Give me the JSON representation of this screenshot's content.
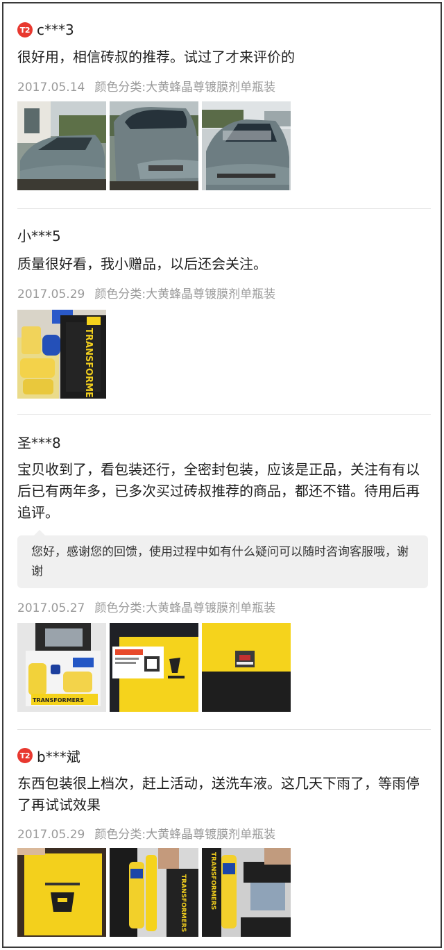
{
  "reviews": [
    {
      "badge": "T2",
      "user": "c***3",
      "content": "很好用，相信砖叔的推荐。试过了才来评价的",
      "date": "2017.05.14",
      "sku": "颜色分类:大黄蜂晶尊镀膜剂单瓶装",
      "photos": [
        "car-front-left",
        "car-side",
        "car-front"
      ]
    },
    {
      "user": "小***5",
      "content": "质量很好看，我小赠品，以后还会关注。",
      "date": "2017.05.29",
      "sku": "颜色分类:大黄蜂晶尊镀膜剂单瓶装",
      "photos": [
        "product-transformers-box"
      ]
    },
    {
      "user": "圣***8",
      "content": "宝贝收到了，看包装还行，全密封包装，应该是正品，关注有有以后已有两年多，已多次买过砖叔推荐的商品，都还不错。待用后再追评。",
      "reply": "您好，感谢您的回馈，使用过程中如有什么疑问可以随时咨询客服哦，谢谢",
      "date": "2017.05.27",
      "sku": "颜色分类:大黄蜂晶尊镀膜剂单瓶装",
      "photos": [
        "open-box-kit",
        "yellow-package-card",
        "yellow-package-label"
      ]
    },
    {
      "badge": "T2",
      "user": "b***斌",
      "content": "东西包装很上档次，赶上活动，送洗车液。这几天下雨了，等雨停了再试试效果",
      "date": "2017.05.29",
      "sku": "颜色分类:大黄蜂晶尊镀膜剂单瓶装",
      "photos": [
        "yellow-box-logo",
        "bottles-in-hand",
        "bottles-box"
      ]
    }
  ],
  "colors": {
    "badge": "#e8382f",
    "meta": "#9a9a9a",
    "reply_bg": "#f0f0f0",
    "product_yellow": "#f5d31c"
  }
}
